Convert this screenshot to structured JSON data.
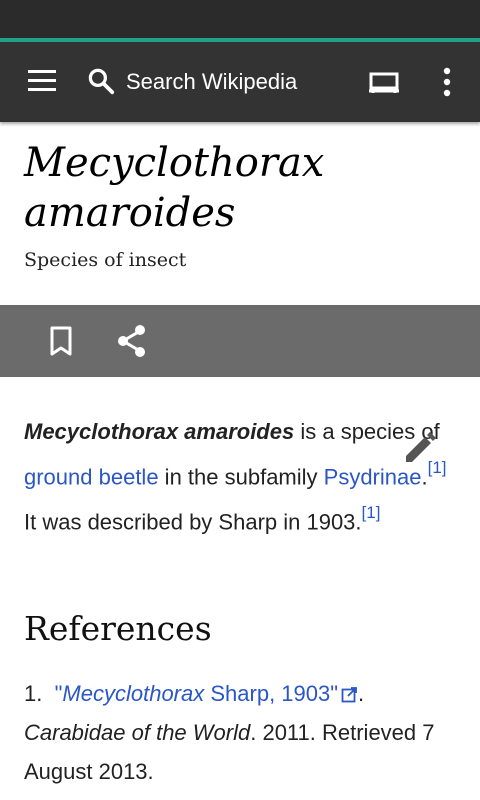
{
  "toolbar": {
    "search_placeholder": "Search Wikipedia",
    "accent_color": "#1fa38a",
    "icons": [
      "menu-icon",
      "search-icon",
      "tabs-icon",
      "more-vert-icon"
    ]
  },
  "article": {
    "title_line1": "Mecyclothorax",
    "title_line2": "amaroides",
    "description": "Species of insect",
    "actions": [
      "bookmark-icon",
      "share-icon"
    ],
    "intro": {
      "bold_name": "Mecyclothorax amaroides",
      "text1": " is a species of ",
      "link1": "ground beetle",
      "text2": " in the subfamily ",
      "link2": "Psydrinae",
      "text3": ".",
      "ref1": "[1]",
      "text4": " It was described by Sharp in 1903.",
      "ref2": "[1]"
    }
  },
  "references": {
    "heading": "References",
    "items": [
      {
        "number": "1.",
        "link_open_quote": "\"",
        "link_italic": "Mecyclothorax",
        "link_rest": " Sharp, 1903\"",
        "after_link": ".",
        "source_italic": "Carabidae of the World",
        "rest": ". 2011. Retrieved 7 August 2013."
      }
    ]
  }
}
